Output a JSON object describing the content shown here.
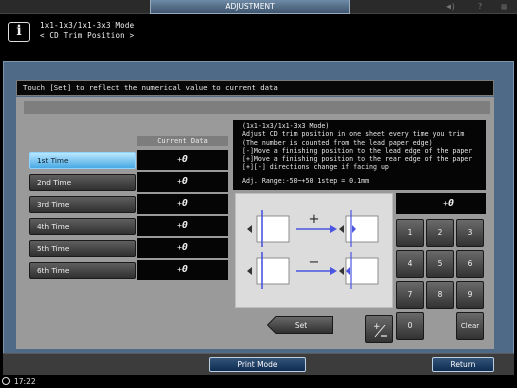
{
  "window": {
    "tab_title": "ADJUSTMENT"
  },
  "top_icons": [
    "speaker-icon",
    "help-icon",
    "menu-icon"
  ],
  "header": {
    "title_line1": "1x1-1x3/1x1-3x3 Mode",
    "title_line2": "< CD Trim Position >"
  },
  "message": "Touch [Set] to reflect the numerical value to current data",
  "table": {
    "header": "Current Data",
    "rows": [
      {
        "label": "1st Time",
        "value": "0",
        "prefix": "+",
        "selected": true
      },
      {
        "label": "2nd Time",
        "value": "0",
        "prefix": "+"
      },
      {
        "label": "3rd Time",
        "value": "0",
        "prefix": "+"
      },
      {
        "label": "4th Time",
        "value": "0",
        "prefix": "+"
      },
      {
        "label": "5th Time",
        "value": "0",
        "prefix": "+"
      },
      {
        "label": "6th Time",
        "value": "0",
        "prefix": "+"
      }
    ]
  },
  "info": {
    "line1": "(1x1-1x3/1x1-3x3 Mode)",
    "line2": "Adjust CD trim position in one sheet every time you trim",
    "line3": "(The number is counted from the lead paper edge)",
    "line4": "[-]Move a finishing position to the lead edge of the paper",
    "line5": "[+]Move a finishing position to the rear edge of the paper",
    "line6": "[+][-] directions change if facing up",
    "line7": "Adj. Range:-50~+50 1step = 0.1mm"
  },
  "diagram": {
    "plus_sign": "+",
    "minus_sign": "−"
  },
  "keypad": {
    "display_prefix": "+",
    "display_value": "0",
    "keys": [
      "1",
      "2",
      "3",
      "4",
      "5",
      "6",
      "7",
      "8",
      "9",
      "0"
    ],
    "clear_label": "Clear",
    "plusminus_label": "+/−"
  },
  "set_label": "Set",
  "bottom": {
    "print_mode_label": "Print Mode",
    "return_label": "Return"
  },
  "status": {
    "time": "17:22"
  },
  "colors": {
    "selected": "#48a9e3",
    "panel": "#4e6a86",
    "button": "#0e2c50"
  }
}
